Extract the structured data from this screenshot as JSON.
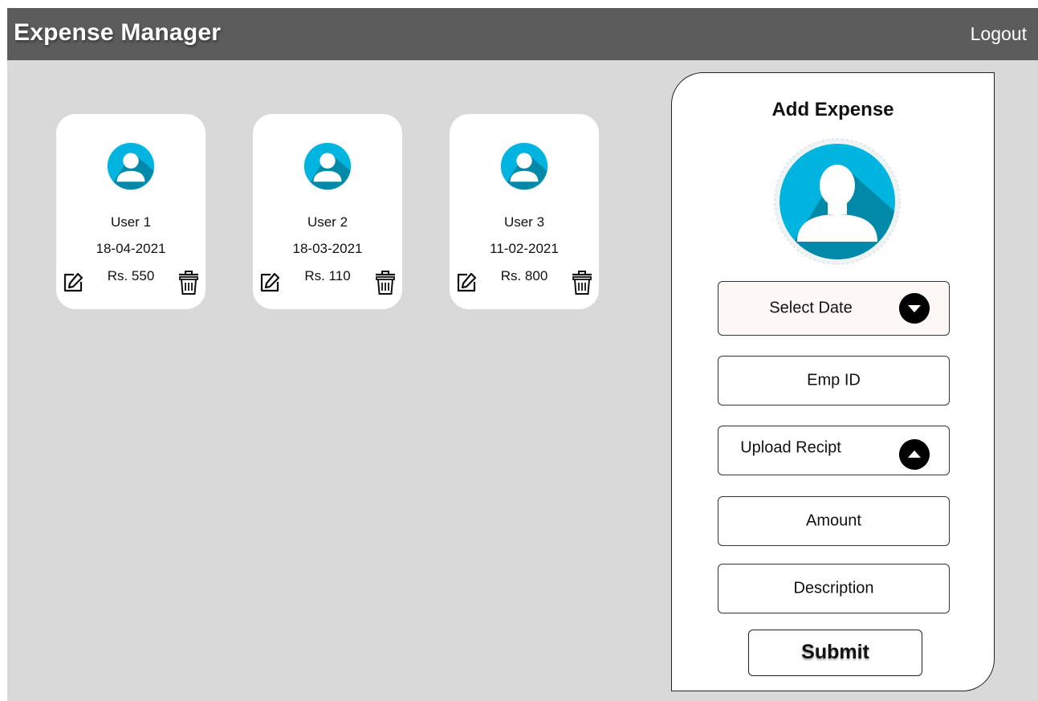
{
  "header": {
    "title": "Expense Manager",
    "logout_label": "Logout"
  },
  "users": [
    {
      "name": "User 1",
      "date": "18-04-2021",
      "amount": "Rs. 550"
    },
    {
      "name": "User 2",
      "date": "18-03-2021",
      "amount": "Rs. 110"
    },
    {
      "name": "User 3",
      "date": "11-02-2021",
      "amount": "Rs. 800"
    }
  ],
  "form": {
    "title": "Add Expense",
    "select_date_label": "Select Date",
    "emp_id_label": "Emp ID",
    "upload_label": "Upload Recipt",
    "amount_label": "Amount",
    "description_label": "Description",
    "submit_label": "Submit"
  },
  "icons": {
    "avatar": "user-avatar-icon",
    "edit": "edit-icon",
    "delete": "trash-icon",
    "dropdown": "chevron-down-circle-icon",
    "upload": "chevron-up-circle-icon"
  },
  "colors": {
    "header_bg": "#5c5c5c",
    "page_bg": "#d9d9d9",
    "avatar_light": "#00b4e0",
    "avatar_dark": "#0089a8"
  }
}
